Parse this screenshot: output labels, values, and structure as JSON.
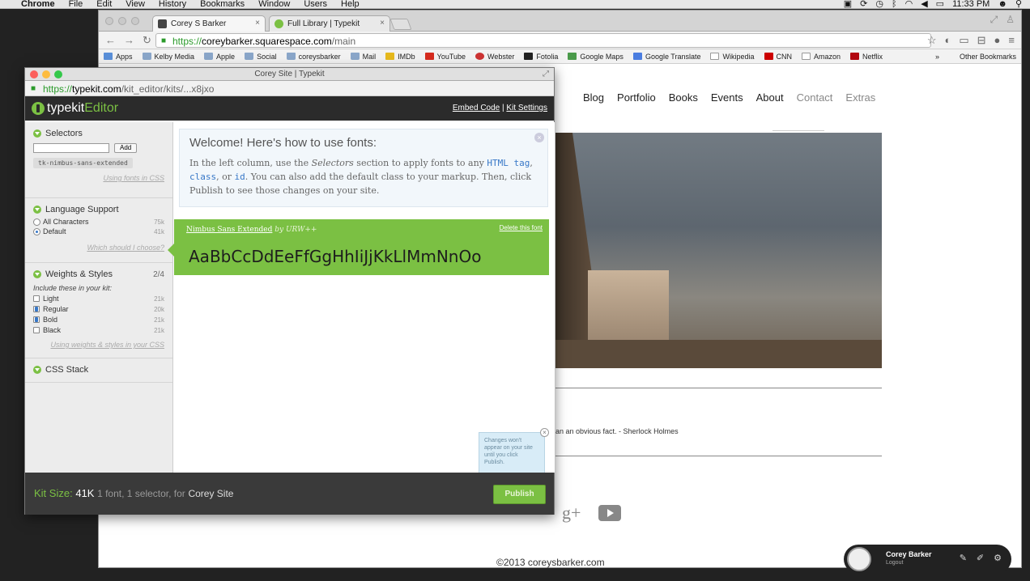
{
  "menubar": {
    "apple": "",
    "items": [
      "Chrome",
      "File",
      "Edit",
      "View",
      "History",
      "Bookmarks",
      "Window",
      "Users",
      "Help"
    ],
    "clock": "11:33 PM"
  },
  "browser": {
    "tabs": [
      {
        "label": "Corey S Barker",
        "close": "×"
      },
      {
        "label": "Full Library | Typekit",
        "close": "×"
      }
    ],
    "url": {
      "scheme": "https://",
      "domain": "coreybarker.squarespace.com",
      "path": "/main"
    },
    "bookmarks": [
      "Apps",
      "Kelby Media",
      "Apple",
      "Social",
      "coreysbarker",
      "Mail",
      "IMDb",
      "YouTube",
      "Webster",
      "Fotolia",
      "Google Maps",
      "Google Translate",
      "Wikipedia",
      "CNN",
      "Amazon",
      "Netflix"
    ],
    "bookmarks_more": "»",
    "other_bookmarks": "Other Bookmarks"
  },
  "site": {
    "nav": [
      "Blog",
      "Portfolio",
      "Books",
      "Events",
      "About",
      "Contact",
      "Extras"
    ],
    "quote": "an an obvious fact. - Sherlock Holmes",
    "gplus": "g+",
    "copyright": "©2013 coreysbarker.com",
    "user": {
      "name": "Corey Barker",
      "logout": "Logout"
    }
  },
  "typekit": {
    "window_title": "Corey Site | Typekit",
    "url": {
      "scheme": "https://",
      "domain": "typekit.com",
      "path": "/kit_editor/kits/...x8jxo"
    },
    "logo": {
      "part1": "typekit",
      "part2": "Editor"
    },
    "links": {
      "embed": "Embed Code",
      "sep": " | ",
      "settings": "Kit Settings"
    },
    "selectors": {
      "title": "Selectors",
      "add": "Add",
      "chip": "tk-nimbus-sans-extended",
      "link": "Using fonts in CSS"
    },
    "language": {
      "title": "Language Support",
      "options": [
        {
          "label": "All Characters",
          "size": "75k",
          "selected": false
        },
        {
          "label": "Default",
          "size": "41k",
          "selected": true
        }
      ],
      "link": "Which should I choose?"
    },
    "weights": {
      "title": "Weights & Styles",
      "count": "2/4",
      "hint": "Include these in your kit:",
      "items": [
        {
          "label": "Light",
          "size": "21k",
          "checked": false
        },
        {
          "label": "Regular",
          "size": "20k",
          "checked": true
        },
        {
          "label": "Bold",
          "size": "21k",
          "checked": true
        },
        {
          "label": "Black",
          "size": "21k",
          "checked": false
        }
      ],
      "link": "Using weights & styles in your CSS"
    },
    "css_stack": {
      "title": "CSS Stack"
    },
    "welcome": {
      "heading": "Welcome! Here's how to use fonts:",
      "p1": "In the left column, use the ",
      "p1_em": "Selectors",
      "p1_b": " section to apply fonts to any ",
      "code1": "HTML tag",
      "p1_c": ", ",
      "code2": "class",
      "p1_d": ", or ",
      "code3": "id",
      "p1_e": ". You can also add the default class to your markup. Then, click Publish to see those changes on your site."
    },
    "font": {
      "name": "Nimbus Sans Extended",
      "by": "by URW++",
      "delete": "Delete this font",
      "sample": "AaBbCcDdEeFfGgHhIiJjKkLlMmNnOo"
    },
    "tooltip": "Changes won't appear on your site until you click Publish.",
    "tooltip_close": "×",
    "footer": {
      "label": "Kit Size:",
      "size": "41K",
      "summary": "1 font, 1 selector, for",
      "site": "Corey Site",
      "publish": "Publish"
    }
  }
}
